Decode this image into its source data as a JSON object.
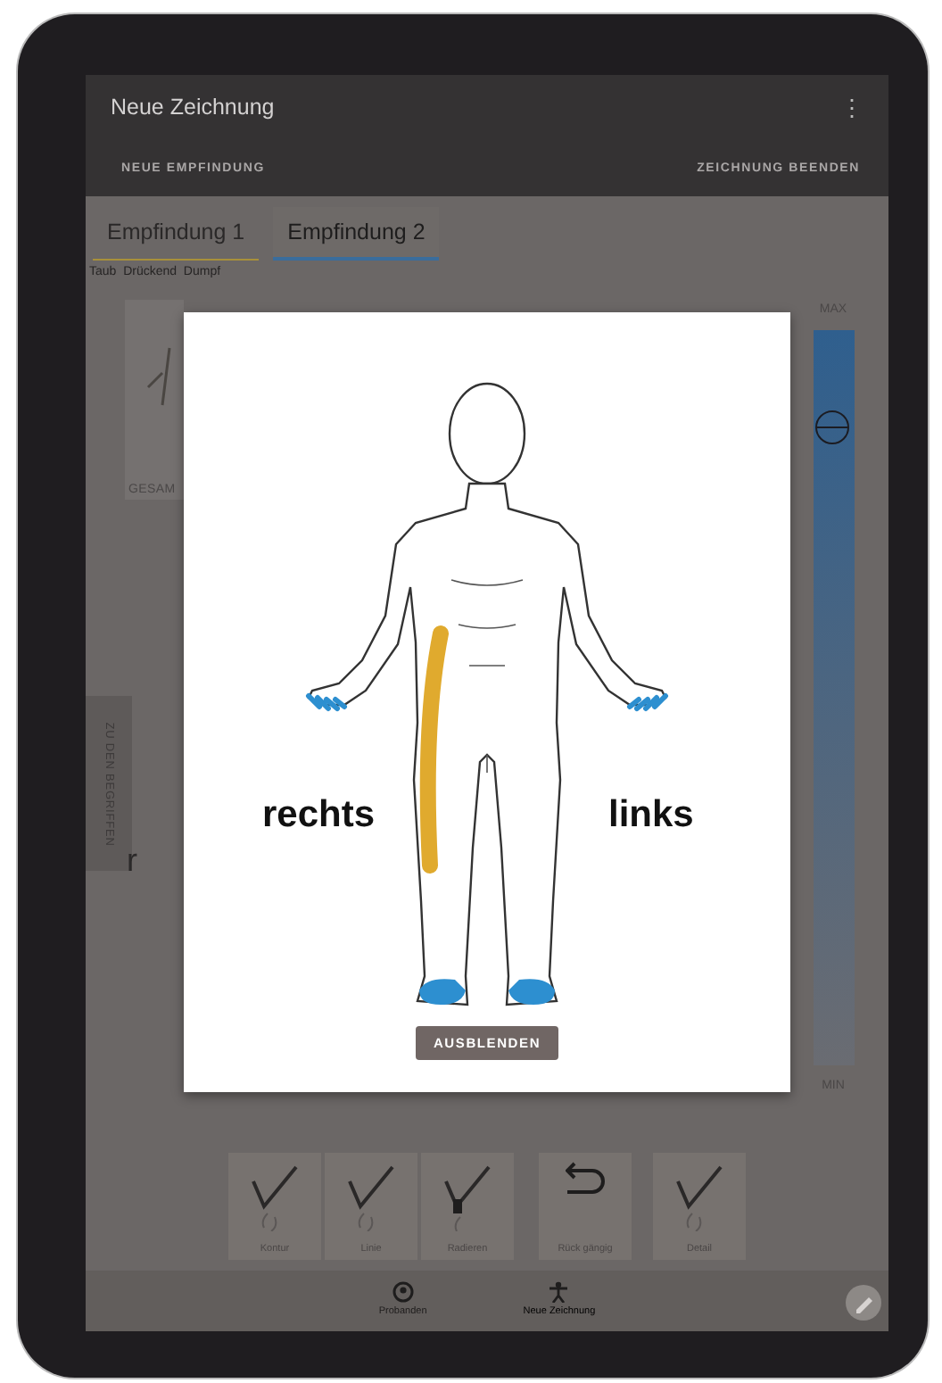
{
  "app_bar": {
    "title": "Neue Zeichnung",
    "menu_icon": "⋮",
    "actions": [
      {
        "label": "NEUE EMPFINDUNG"
      },
      {
        "label": "ZEICHNUNG BEENDEN"
      }
    ]
  },
  "tabs": [
    {
      "label": "Empfindung 1",
      "selected": false,
      "color": "#a8903a"
    },
    {
      "label": "Empfindung 2",
      "selected": true,
      "color": "#3a6d9c"
    }
  ],
  "descriptors": "Taub  Drückend  Dumpf",
  "thumbnail": {
    "label": "GESAM"
  },
  "side_tab": "ZU DEN BEGRIFFEN",
  "partial_text": "r",
  "intensity": {
    "max_label": "MAX",
    "min_label": "MIN",
    "level": 0.87
  },
  "dialog": {
    "right_label": "rechts",
    "left_label": "links",
    "button": "AUSBLENDEN"
  },
  "tools": [
    {
      "label": "Kontur",
      "kind": "pen"
    },
    {
      "label": "Linie",
      "kind": "pen"
    },
    {
      "label": "Radieren",
      "kind": "eraser"
    },
    {
      "label": "Rück gängig",
      "kind": "undo"
    },
    {
      "label": "Detail",
      "kind": "pen"
    }
  ],
  "nav": [
    {
      "label": "Probanden",
      "kind": "person"
    },
    {
      "label": "Neue Zeichnung",
      "kind": "figure"
    }
  ]
}
